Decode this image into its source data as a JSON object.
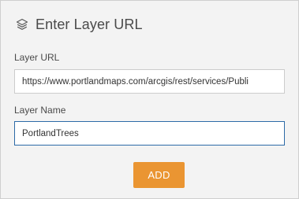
{
  "dialog": {
    "icon": "layers-icon",
    "title": "Enter Layer URL"
  },
  "layer_url": {
    "label": "Layer URL",
    "value": "https://www.portlandmaps.com/arcgis/rest/services/Publi"
  },
  "layer_name": {
    "label": "Layer Name",
    "value": "PortlandTrees"
  },
  "add_button": {
    "label": "ADD"
  },
  "colors": {
    "accent": "#ea9532",
    "focus_border": "#2d6aa7",
    "panel_background": "#f3f3f3"
  }
}
